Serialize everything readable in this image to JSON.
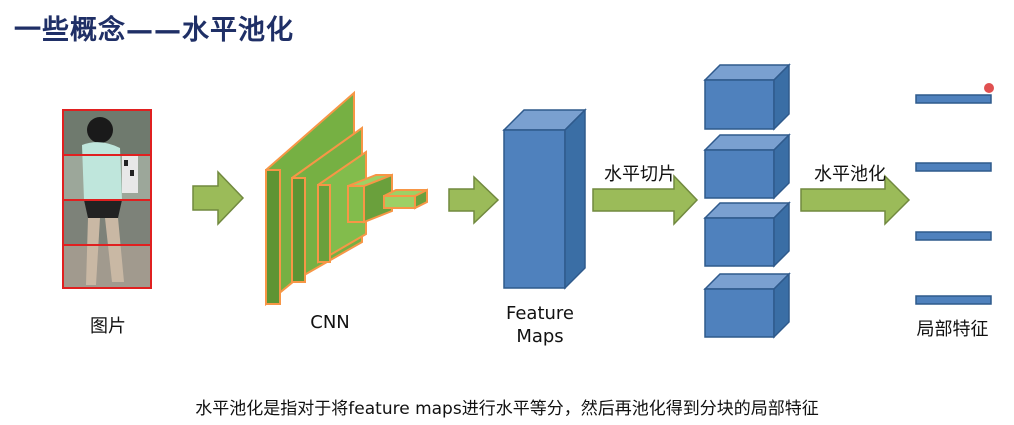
{
  "title": "一些概念——水平池化",
  "labels": {
    "image": "图片",
    "cnn": "CNN",
    "feature_maps_line1": "Feature",
    "feature_maps_line2": "Maps",
    "slice_arrow": "水平切片",
    "pool_arrow": "水平池化",
    "local_features": "局部特征"
  },
  "caption": "水平池化是指对于将feature maps进行水平等分，然后再池化得到分块的局部特征",
  "colors": {
    "title": "#1f2f66",
    "arrow_fill": "#9bbb59",
    "arrow_stroke": "#71893f",
    "cnn_fill": "#76b043",
    "cnn_stroke": "#f79646",
    "cube_front": "#4f81bd",
    "cube_top": "#7aa0d0",
    "cube_side": "#3a6ea5",
    "grid_red": "#e02020"
  }
}
